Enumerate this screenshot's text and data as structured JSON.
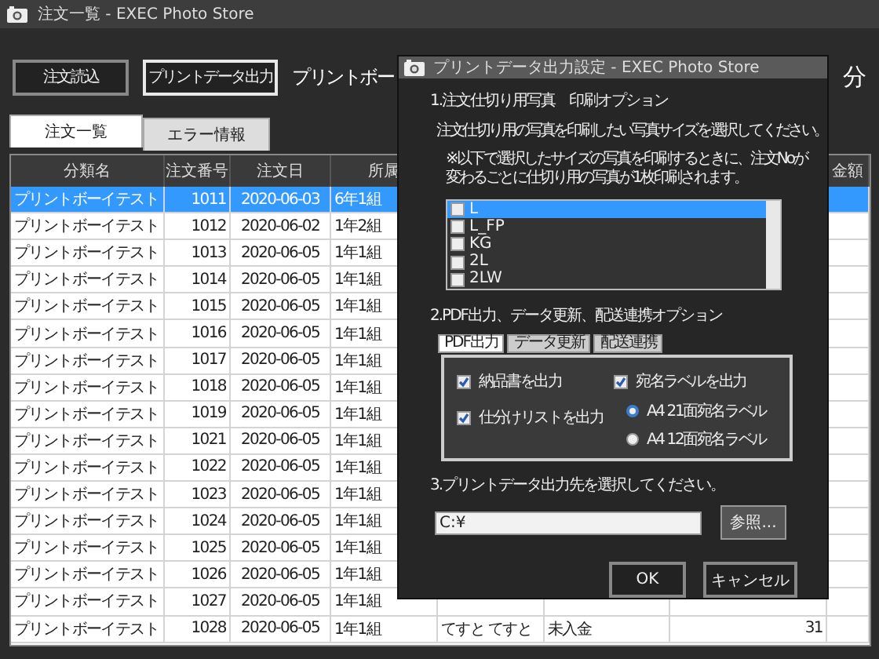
{
  "window": {
    "title": "注文一覧 - EXEC Photo Store"
  },
  "toolbar": {
    "buttons": [
      {
        "label": "注文読込",
        "focused": false
      },
      {
        "label": "プリントデータ出力",
        "focused": true
      }
    ],
    "heading": "プリントボー",
    "heading_tail": "分"
  },
  "tabs": [
    {
      "label": "注文一覧",
      "selected": true
    },
    {
      "label": "エラー情報",
      "selected": false
    }
  ],
  "table": {
    "columns": [
      "分類名",
      "注文番号",
      "注文日",
      "所属"
    ],
    "last_column": "金額",
    "rows": [
      {
        "cells": [
          "プリントボーイテスト",
          "1011",
          "2020-06-03",
          "6年1組"
        ],
        "selected": true
      },
      {
        "cells": [
          "プリントボーイテスト",
          "1012",
          "2020-06-02",
          "1年2組"
        ],
        "selected": false
      },
      {
        "cells": [
          "プリントボーイテスト",
          "1013",
          "2020-06-05",
          "1年1組"
        ],
        "selected": false
      },
      {
        "cells": [
          "プリントボーイテスト",
          "1014",
          "2020-06-05",
          "1年1組"
        ],
        "selected": false
      },
      {
        "cells": [
          "プリントボーイテスト",
          "1015",
          "2020-06-05",
          "1年1組"
        ],
        "selected": false
      },
      {
        "cells": [
          "プリントボーイテスト",
          "1016",
          "2020-06-05",
          "1年1組"
        ],
        "selected": false
      },
      {
        "cells": [
          "プリントボーイテスト",
          "1017",
          "2020-06-05",
          "1年1組"
        ],
        "selected": false
      },
      {
        "cells": [
          "プリントボーイテスト",
          "1018",
          "2020-06-05",
          "1年1組"
        ],
        "selected": false
      },
      {
        "cells": [
          "プリントボーイテスト",
          "1019",
          "2020-06-05",
          "1年1組"
        ],
        "selected": false
      },
      {
        "cells": [
          "プリントボーイテスト",
          "1021",
          "2020-06-05",
          "1年1組"
        ],
        "selected": false
      },
      {
        "cells": [
          "プリントボーイテスト",
          "1022",
          "2020-06-05",
          "1年1組"
        ],
        "selected": false
      },
      {
        "cells": [
          "プリントボーイテスト",
          "1023",
          "2020-06-05",
          "1年1組"
        ],
        "selected": false
      },
      {
        "cells": [
          "プリントボーイテスト",
          "1024",
          "2020-06-05",
          "1年1組"
        ],
        "selected": false
      },
      {
        "cells": [
          "プリントボーイテスト",
          "1025",
          "2020-06-05",
          "1年1組"
        ],
        "selected": false
      },
      {
        "cells": [
          "プリントボーイテスト",
          "1026",
          "2020-06-05",
          "1年1組"
        ],
        "selected": false
      },
      {
        "cells": [
          "プリントボーイテスト",
          "1027",
          "2020-06-05",
          "1年1組"
        ],
        "selected": false
      },
      {
        "cells": [
          "プリントボーイテスト",
          "1028",
          "2020-06-05",
          "1年1組",
          "てすと てすと",
          "未入金",
          "31"
        ],
        "selected": false
      }
    ]
  },
  "dialog": {
    "title": "プリントデータ出力設定 - EXEC Photo Store",
    "section1": {
      "heading": "1.注文仕切り用写真　印刷オプション",
      "instruction": "注文仕切り用の写真を印刷したい写真サイズを選択してください。",
      "note": "※以下で選択したサイズの写真を印刷するときに、注文Noが変わるごとに仕切り用の写真が1枚印刷されます。",
      "sizes": [
        {
          "label": "L",
          "checked": false,
          "selected": true
        },
        {
          "label": "L_FP",
          "checked": false,
          "selected": false
        },
        {
          "label": "KG",
          "checked": false,
          "selected": false
        },
        {
          "label": "2L",
          "checked": false,
          "selected": false
        },
        {
          "label": "2LW",
          "checked": false,
          "selected": false
        }
      ]
    },
    "section2": {
      "heading": "2.PDF出力、データ更新、配送連携オプション",
      "tabs": [
        {
          "label": "PDF出力",
          "selected": true
        },
        {
          "label": "データ更新",
          "selected": false
        },
        {
          "label": "配送連携",
          "selected": false
        }
      ],
      "left_options": [
        {
          "label": "納品書を出力",
          "checked": true
        },
        {
          "label": "仕分けリストを出力",
          "checked": true
        }
      ],
      "label_option": {
        "label": "宛名ラベルを出力",
        "checked": true
      },
      "label_types": [
        {
          "label": "A4 21面宛名ラベル",
          "selected": true
        },
        {
          "label": "A4 12面宛名ラベル",
          "selected": false
        }
      ]
    },
    "section3": {
      "heading": "3.プリントデータ出力先を選択してください。",
      "path": "C:¥",
      "browse": "参照..."
    },
    "buttons": [
      "OK",
      "キャンセル"
    ]
  }
}
